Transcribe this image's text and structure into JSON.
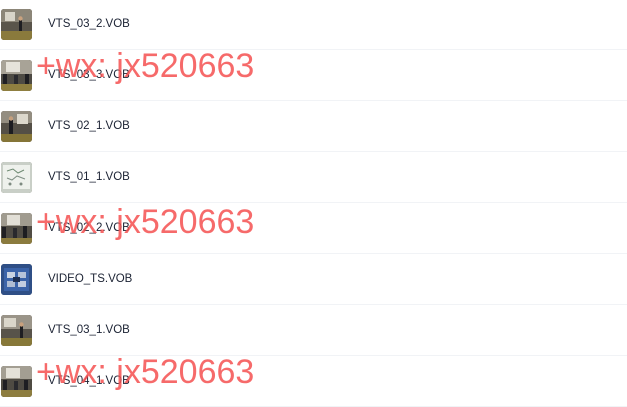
{
  "files": [
    {
      "name": "VTS_03_2.VOB",
      "thumb": "video-frame-speaker"
    },
    {
      "name": "VTS_03_3.VOB",
      "thumb": "video-frame-room"
    },
    {
      "name": "VTS_02_1.VOB",
      "thumb": "video-frame-speaker"
    },
    {
      "name": "VTS_01_1.VOB",
      "thumb": "video-frame-whiteboard"
    },
    {
      "name": "VTS_02_2.VOB",
      "thumb": "video-frame-room"
    },
    {
      "name": "VIDEO_TS.VOB",
      "thumb": "dvd-menu"
    },
    {
      "name": "VTS_03_1.VOB",
      "thumb": "video-frame-speaker"
    },
    {
      "name": "VTS_04_1.VOB",
      "thumb": "video-frame-room"
    }
  ],
  "watermark": {
    "text": "+wx: jx520663",
    "color": "#f55050"
  },
  "colors": {
    "text": "#1b2233",
    "divider": "#f1f3f6"
  }
}
